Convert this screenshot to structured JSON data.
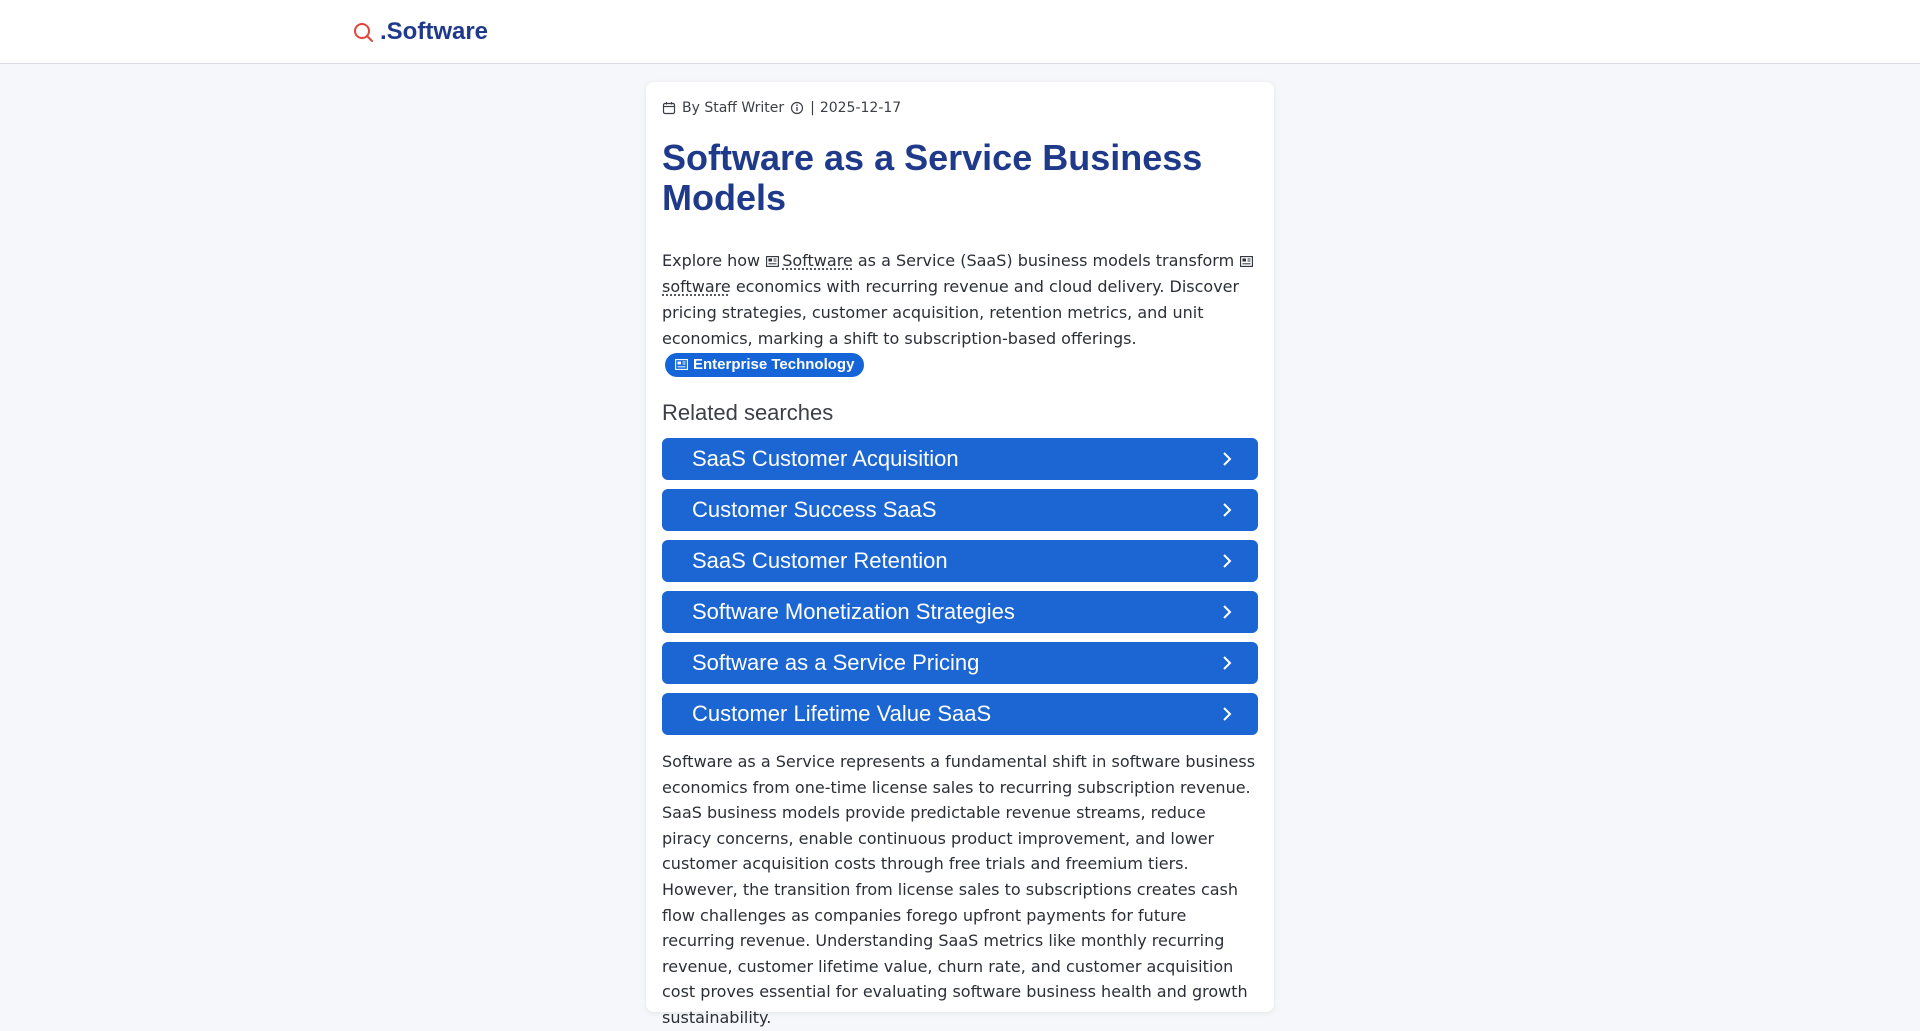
{
  "header": {
    "brand": ".Software",
    "logo_icon": "search-icon",
    "logo_color": "#e0453b",
    "brand_color": "#1f3a8a"
  },
  "article": {
    "author": "By Staff Writer",
    "date_separator": "|",
    "date": "2025-12-17",
    "title": "Software as a Service Business Models",
    "intro": {
      "part1": "Explore how",
      "kw1": "Software",
      "part2": "as a Service (SaaS) business models transform",
      "kw2": "software",
      "part3": "economics with recurring revenue and cloud delivery. Discover pricing strategies, customer acquisition, retention metrics, and unit economics, marking a shift to subscription-based offerings.",
      "tag": "Enterprise Technology"
    },
    "related_title": "Related searches",
    "related": [
      "SaaS Customer Acquisition",
      "Customer Success SaaS",
      "SaaS Customer Retention",
      "Software Monetization Strategies",
      "Software as a Service Pricing",
      "Customer Lifetime Value SaaS"
    ],
    "body": "Software as a Service represents a fundamental shift in software business economics from one-time license sales to recurring subscription revenue. SaaS business models provide predictable revenue streams, reduce piracy concerns, enable continuous product improvement, and lower customer acquisition costs through free trials and freemium tiers. However, the transition from license sales to subscriptions creates cash flow challenges as companies forego upfront payments for future recurring revenue. Understanding SaaS metrics like monthly recurring revenue, customer lifetime value, churn rate, and customer acquisition cost proves essential for evaluating software business health and growth sustainability."
  },
  "colors": {
    "accent": "#1b66d2",
    "title": "#1f3a8a"
  }
}
